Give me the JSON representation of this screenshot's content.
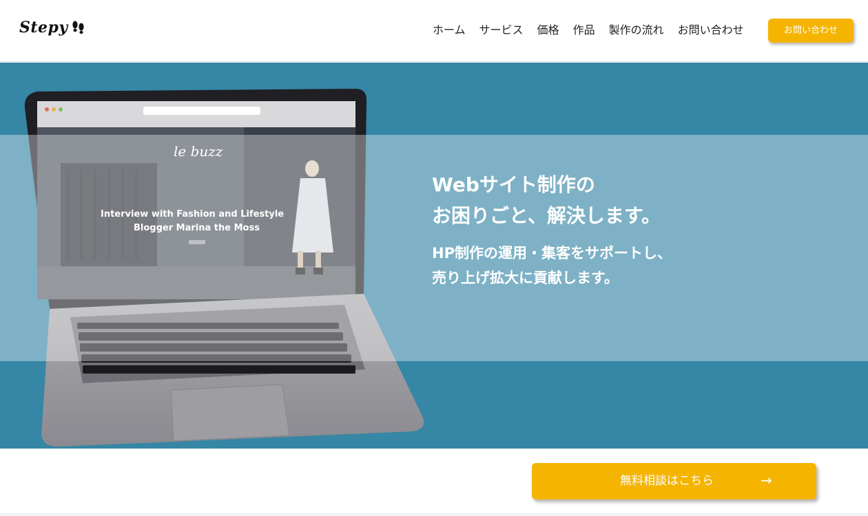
{
  "header": {
    "logo_text": "Stepy",
    "logo_icon": "footprints-icon",
    "nav": [
      {
        "label": "ホーム",
        "name": "nav-home"
      },
      {
        "label": "サービス",
        "name": "nav-service"
      },
      {
        "label": "価格",
        "name": "nav-price"
      },
      {
        "label": "作品",
        "name": "nav-works"
      },
      {
        "label": "製作の流れ",
        "name": "nav-flow"
      },
      {
        "label": "お問い合わせ",
        "name": "nav-contact"
      }
    ],
    "cta_label": "お問い合わせ"
  },
  "hero": {
    "title_line1": "Webサイト制作の",
    "title_line2": "お困りごと、解決します。",
    "sub_line1": "HP制作の運用・集客をサポートし、",
    "sub_line2": "売り上げ拡大に貢献します。",
    "laptop_screen": {
      "logo": "le buzz",
      "headline_line1": "Interview with Fashion and Lifestyle",
      "headline_line2": "Blogger Marina the Moss"
    }
  },
  "cta": {
    "label": "無料相談はこちら",
    "arrow": "→"
  },
  "colors": {
    "accent": "#f4b400",
    "hero_bg": "#3686a5",
    "white": "#ffffff"
  }
}
